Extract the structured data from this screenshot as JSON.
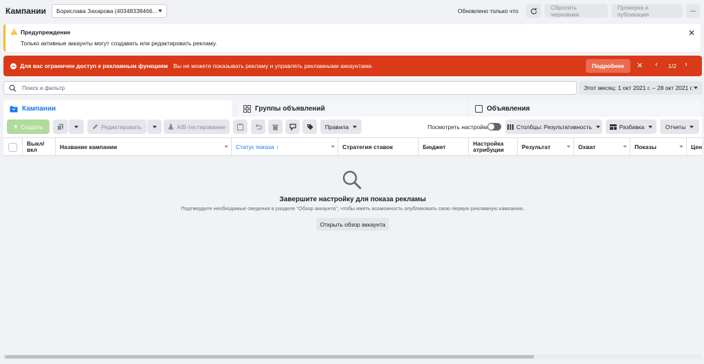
{
  "topbar": {
    "title": "Кампании",
    "account": "Борислава Захарова (40348338466...",
    "updated": "Обновлено только что",
    "discard_drafts": "Сбросить черновики",
    "review_publish": "Проверка и публикация",
    "more": "···"
  },
  "warning": {
    "title": "Предупреждение",
    "text": "Только активные аккаунты могут создавать или редактировать рекламу."
  },
  "error": {
    "title": "Для вас ограничен доступ к рекламным функциям",
    "text": "Вы не можете показывать рекламу и управлять рекламными аккаунтами.",
    "more": "Подробнее",
    "page": "1/2"
  },
  "search": {
    "placeholder": "Поиск и фильтр",
    "daterange": "Этот месяц: 1 окт 2021 г. – 28 окт 2021 г."
  },
  "tabs": [
    {
      "label": "Кампании"
    },
    {
      "label": "Группы объявлений"
    },
    {
      "label": "Объявления"
    }
  ],
  "toolbar": {
    "create": "Создать",
    "edit": "Редактировать",
    "ab_test": "A/B-тестирование",
    "rules": "Правила",
    "view_settings": "Посмотреть настройки",
    "columns": "Столбцы: Результативность",
    "breakdown": "Разбивка",
    "reports": "Отчеты"
  },
  "table": {
    "columns": [
      "Выкл/ вкл",
      "Название кампании",
      "Статус показа ↑",
      "Стратегия ставок",
      "Бюджет",
      "Настройка атрибуции",
      "Результат",
      "Охват",
      "Показы",
      "Цена"
    ]
  },
  "empty": {
    "heading": "Завершите настройку для показа рекламы",
    "text": "Подтвердите необходимые сведения в разделе \"Обзор аккаунта\", чтобы иметь возможность опубликовать свою первую рекламную кампанию.",
    "button": "Открыть обзор аккаунта"
  },
  "colors": {
    "brand_blue": "#1877f2",
    "error_red": "#d93a17",
    "warning_yellow": "#f7b928",
    "create_green": "#b1db9c"
  }
}
